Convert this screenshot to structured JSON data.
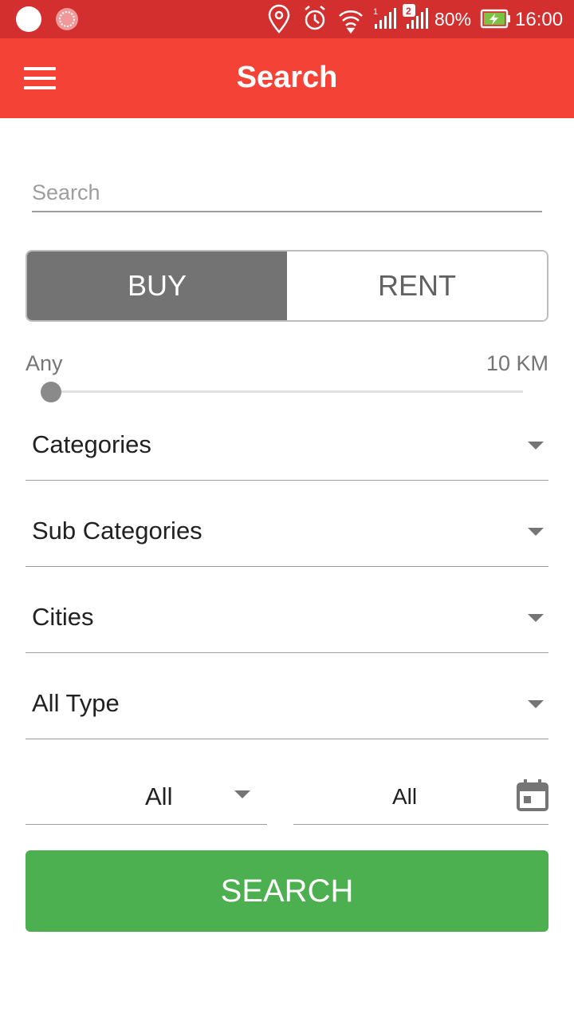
{
  "status_bar": {
    "signal_sim1": "1",
    "signal_sim2": "2",
    "battery": "80%",
    "time": "16:00"
  },
  "app_bar": {
    "title": "Search",
    "menu_icon": "hamburger-menu-icon"
  },
  "search": {
    "placeholder": "Search",
    "value": ""
  },
  "listing_type": {
    "options": [
      "BUY",
      "RENT"
    ],
    "selected": "BUY"
  },
  "distance": {
    "min_label": "Any",
    "max_label": "10 KM",
    "value_fraction": 0
  },
  "filters": {
    "categories": "Categories",
    "sub_categories": "Sub Categories",
    "cities": "Cities",
    "type": "All Type",
    "left_select": "All",
    "date": "All"
  },
  "search_button": "SEARCH",
  "colors": {
    "status_bar": "#d32f2f",
    "app_bar": "#f44336",
    "segment_active": "#737373",
    "search_button": "#4caf50"
  }
}
